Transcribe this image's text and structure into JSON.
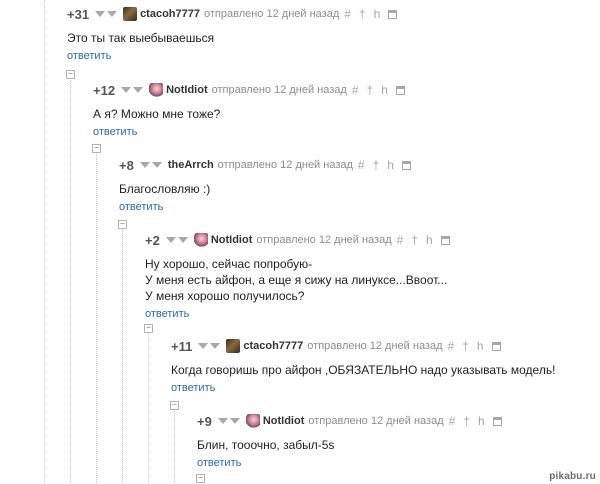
{
  "comments": [
    {
      "rating": "+31",
      "author": "ctacoh7777",
      "avatar": "ctacoh-avatar",
      "meta": "отправлено 12 дней назад",
      "lines": [
        "Это ты так выебываешься"
      ],
      "reply": "ответить"
    },
    {
      "rating": "+12",
      "author": "NotIdiot",
      "avatar": "notidiot-avatar",
      "meta": "отправлено 12 дней назад",
      "lines": [
        "А я? Можно мне тоже?"
      ],
      "reply": "ответить"
    },
    {
      "rating": "+8",
      "author": "theArrch",
      "avatar": "",
      "meta": "отправлено 12 дней назад",
      "lines": [
        "Благословляю :)"
      ],
      "reply": "ответить"
    },
    {
      "rating": "+2",
      "author": "NotIdiot",
      "avatar": "notidiot-avatar",
      "meta": "отправлено 12 дней назад",
      "lines": [
        "Ну хорошо, сейчас попробую-",
        "У меня есть айфон, а еще я сижу на линуксе...Ввоот...",
        "У меня хорошо получилось?"
      ],
      "reply": "ответить"
    },
    {
      "rating": "+11",
      "author": "ctacoh7777",
      "avatar": "ctacoh-avatar",
      "meta": "отправлено 12 дней назад",
      "lines": [
        "Когда говоришь про айфон ,ОБЯЗАТЕЛЬНО надо указывать модель!"
      ],
      "reply": "ответить"
    },
    {
      "rating": "+9",
      "author": "NotIdiot",
      "avatar": "notidiot-avatar",
      "meta": "отправлено 12 дней назад",
      "lines": [
        "Блин, тооочно, забыл-5s"
      ],
      "reply": "ответить"
    }
  ],
  "tool_icons": [
    "hash-icon",
    "pin-icon",
    "link-icon",
    "save-icon"
  ],
  "watermark": "pikabu.ru",
  "colors": {
    "reply_link": "#2a6aa8",
    "meta": "#8d8d8d",
    "guide": "#c9c9c9"
  }
}
